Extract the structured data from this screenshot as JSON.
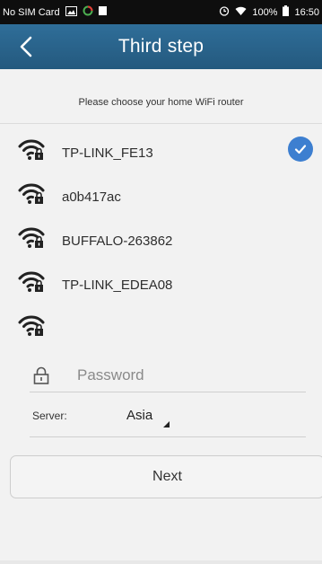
{
  "status_bar": {
    "carrier": "No SIM Card",
    "battery": "100%",
    "time": "16:50",
    "icons": [
      "image-icon",
      "sync-icon",
      "signal-icon",
      "alarm-icon",
      "wifi-icon",
      "battery-icon"
    ]
  },
  "header": {
    "title": "Third step",
    "back_icon": "chevron-left-icon",
    "color": "#2a6590"
  },
  "prompt": "Please choose your home WiFi router",
  "networks": [
    {
      "ssid": "TP-LINK_FE13",
      "selected": true
    },
    {
      "ssid": "a0b417ac",
      "selected": false
    },
    {
      "ssid": "BUFFALO-263862",
      "selected": false
    },
    {
      "ssid": "TP-LINK_EDEA08",
      "selected": false
    },
    {
      "ssid": "",
      "selected": false
    }
  ],
  "password": {
    "placeholder": "Password",
    "value": ""
  },
  "server": {
    "label": "Server:",
    "value": "Asia"
  },
  "next_label": "Next",
  "accent": "#3d7fd0"
}
